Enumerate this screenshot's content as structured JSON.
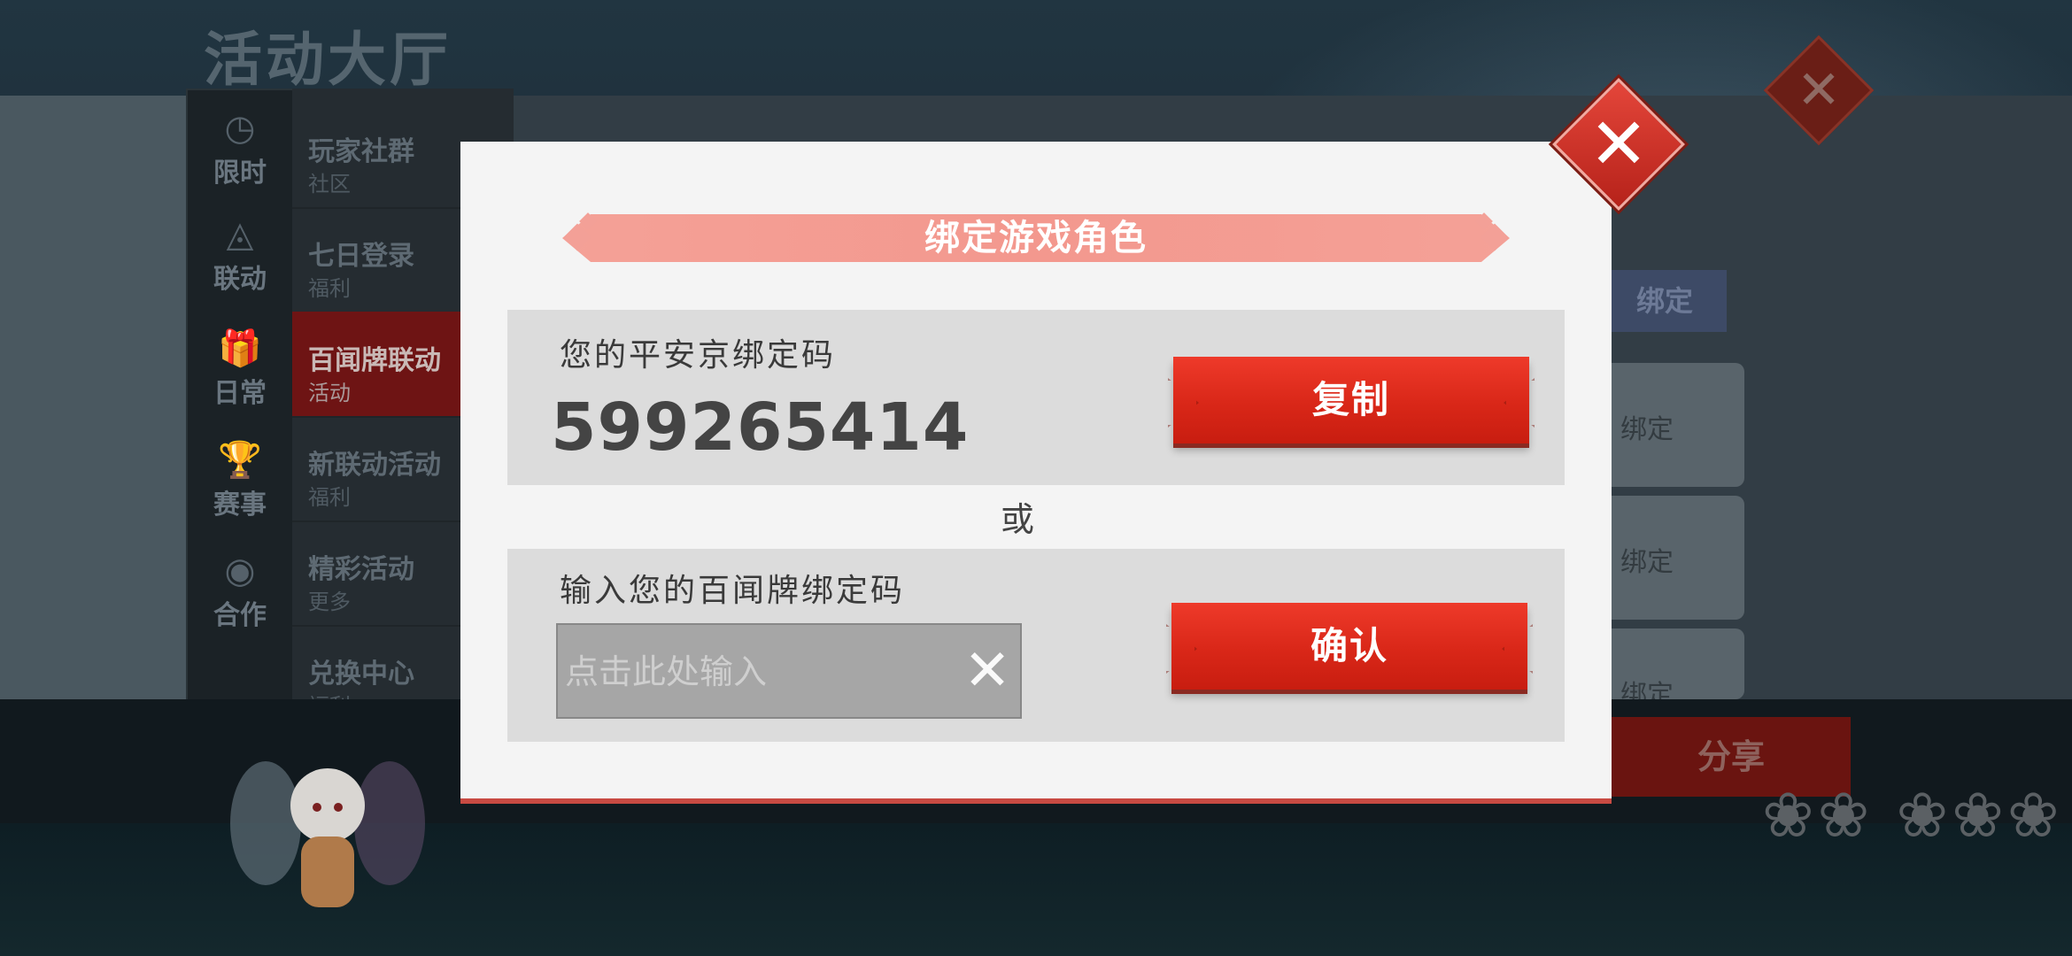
{
  "background": {
    "hall_title": "活动大厅",
    "side_tabs": [
      {
        "label": "限时",
        "icon": "clock-icon",
        "glyph": "◷"
      },
      {
        "label": "联动",
        "icon": "link-icon",
        "glyph": "◬"
      },
      {
        "label": "日常",
        "icon": "gift-icon",
        "glyph": "🎁"
      },
      {
        "label": "赛事",
        "icon": "trophy-icon",
        "glyph": "🏆"
      },
      {
        "label": "合作",
        "icon": "handshake-icon",
        "glyph": "◉"
      }
    ],
    "menu_items": [
      {
        "title": "玩家社群",
        "sub": "社区"
      },
      {
        "title": "七日登录",
        "sub": "福利"
      },
      {
        "title": "百闻牌联动",
        "sub": "活动"
      },
      {
        "title": "新联动活动",
        "sub": "福利"
      },
      {
        "title": "精彩活动",
        "sub": "更多"
      },
      {
        "title": "兑换中心",
        "sub": "福利"
      }
    ],
    "bind_header": "绑定",
    "bind_chips": [
      "绑定",
      "绑定",
      "绑定"
    ],
    "share_label": "分享",
    "flowers": "❀❀ ❀❀❀"
  },
  "dialog": {
    "title": "绑定游戏角色",
    "my_code_label": "您的平安京绑定码",
    "my_code": "599265414",
    "copy_button": "复制",
    "or": "或",
    "input_label": "输入您的百闻牌绑定码",
    "input_placeholder": "点击此处输入",
    "input_value": "",
    "confirm_button": "确认",
    "close_glyph": "✕",
    "clear_glyph": "✕"
  },
  "colors": {
    "accent_red": "#d92718",
    "title_bar": "#f3988e",
    "dialog_bg": "#f4f4f4",
    "section_bg": "#dcdcdc"
  }
}
